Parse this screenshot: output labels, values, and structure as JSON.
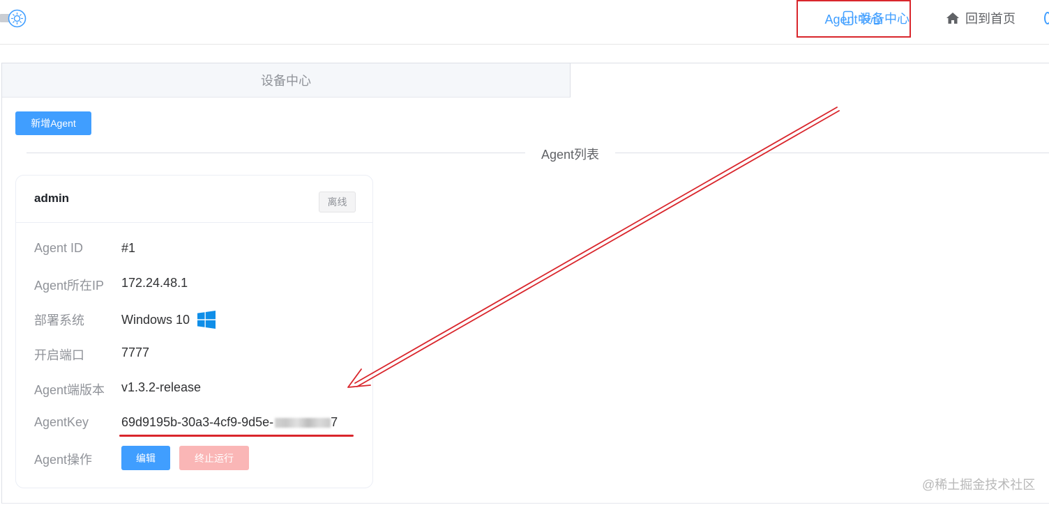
{
  "header": {
    "nav_device_label": "设备中心",
    "nav_home_label": "回到首页",
    "accent_color": "#409eff"
  },
  "tabs": [
    {
      "label": "设备中心",
      "active": false
    },
    {
      "label": "Agent中心",
      "active": true
    }
  ],
  "toolbar": {
    "add_agent_label": "新增Agent"
  },
  "section": {
    "divider_label": "Agent列表"
  },
  "agent_card": {
    "name": "admin",
    "status": "离线",
    "fields": [
      {
        "key": "Agent ID",
        "value": "#1"
      },
      {
        "key": "Agent所在IP",
        "value": "172.24.48.1"
      },
      {
        "key": "部署系统",
        "value": "Windows 10",
        "icon": "windows-icon"
      },
      {
        "key": "开启端口",
        "value": "7777"
      },
      {
        "key": "Agent端版本",
        "value": "v1.3.2-release"
      },
      {
        "key": "AgentKey",
        "value": "69d9195b-30a3-4cf9-9d5e-",
        "value_tail": "7",
        "redacted": true
      }
    ],
    "actions_label": "Agent操作",
    "edit_label": "编辑",
    "stop_label": "终止运行"
  },
  "annotation": {
    "highlight_color": "#d9262c"
  },
  "watermark": "@稀土掘金技术社区"
}
